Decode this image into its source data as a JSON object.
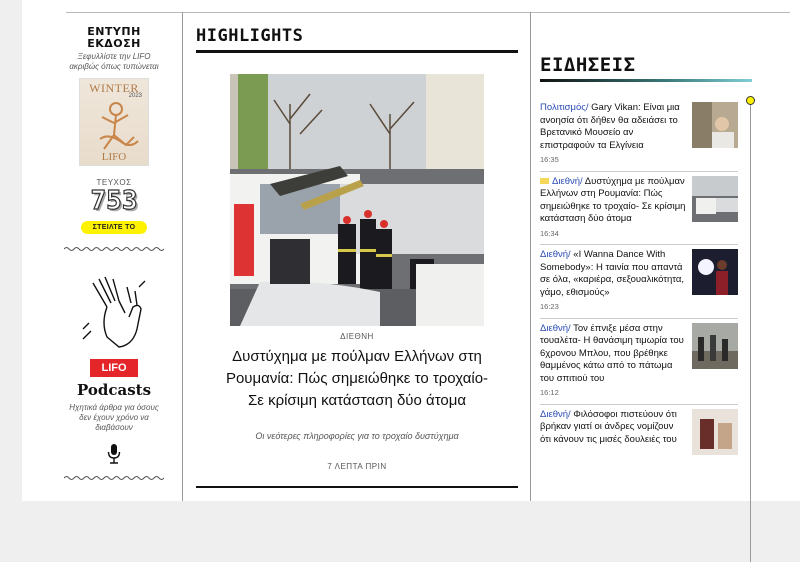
{
  "left": {
    "print_title": "ΕΝΤΥΠΗ ΕΚΔΟΣΗ",
    "print_sub": "Ξεφυλλίστε την LIFO ακριβώς όπως τυπώνεται",
    "cover_word": "WINTER",
    "cover_year": "2023",
    "cover_logo": "LIFO",
    "issue_label": "ΤΕΥΧΟΣ",
    "issue_number": "753",
    "send_button": "ΣΤΕΙΛΤΕ ΤΟ",
    "podcast_logo": "LIFO",
    "podcast_title": "Podcasts",
    "podcast_sub": "Ηχητικά άρθρα για όσους δεν έχουν χρόνο να διαβάσουν"
  },
  "center": {
    "section_title": "HIGHLIGHTS",
    "article": {
      "category": "ΔΙΕΘΝΗ",
      "title": "Δυστύχημα με πούλμαν Ελλήνων στη Ρουμανία: Πώς σημειώθηκε το τροχαίο- Σε κρίσιμη κατάσταση δύο άτομα",
      "subtitle": "Οι νεότερες πληροφορίες για το τροχαίο δυστύχημα",
      "time": "7 ΛΕΠΤΑ ΠΡΙΝ"
    }
  },
  "right": {
    "section_title": "ΕΙΔΗΣΕΙΣ",
    "items": [
      {
        "category": "Πολιτισμός/",
        "title": " Gary Vikan: Είναι μια ανοησία ότι δήθεν θα αδειάσει το Βρετανικό Μουσείο αν επιστραφούν τα Ελγίνεια",
        "time": "16:35",
        "folder": false
      },
      {
        "category": "Διεθνή/",
        "title": " Δυστύχημα με πούλμαν Ελλήνων στη Ρουμανία: Πώς σημειώθηκε το τροχαίο- Σε κρίσιμη κατάσταση δύο άτομα",
        "time": "16:34",
        "folder": true
      },
      {
        "category": "Διεθνή/",
        "title": " «I Wanna Dance With Somebody»: Η ταινία που απαντά σε όλα, «καριέρα, σεξουαλικότητα, γάμο, εθισμούς»",
        "time": "16:23",
        "folder": false
      },
      {
        "category": "Διεθνή/",
        "title": " Τον έπνιξε μέσα στην τουαλέτα- Η θανάσιμη τιμωρία του 6χρονου Μπλου, που βρέθηκε θαμμένος κάτω από το πάτωμα του σπιτιού του",
        "time": "16:12",
        "folder": false
      },
      {
        "category": "Διεθνή/",
        "title": " Φιλόσοφοι πιστεύουν ότι βρήκαν γιατί οι άνδρες νομίζουν ότι κάνουν τις μισές δουλειές του",
        "time": "",
        "folder": false
      }
    ]
  },
  "colors": {
    "accent_yellow": "#fff200",
    "link_blue": "#2a4db5",
    "lifo_red": "#e4262a"
  }
}
